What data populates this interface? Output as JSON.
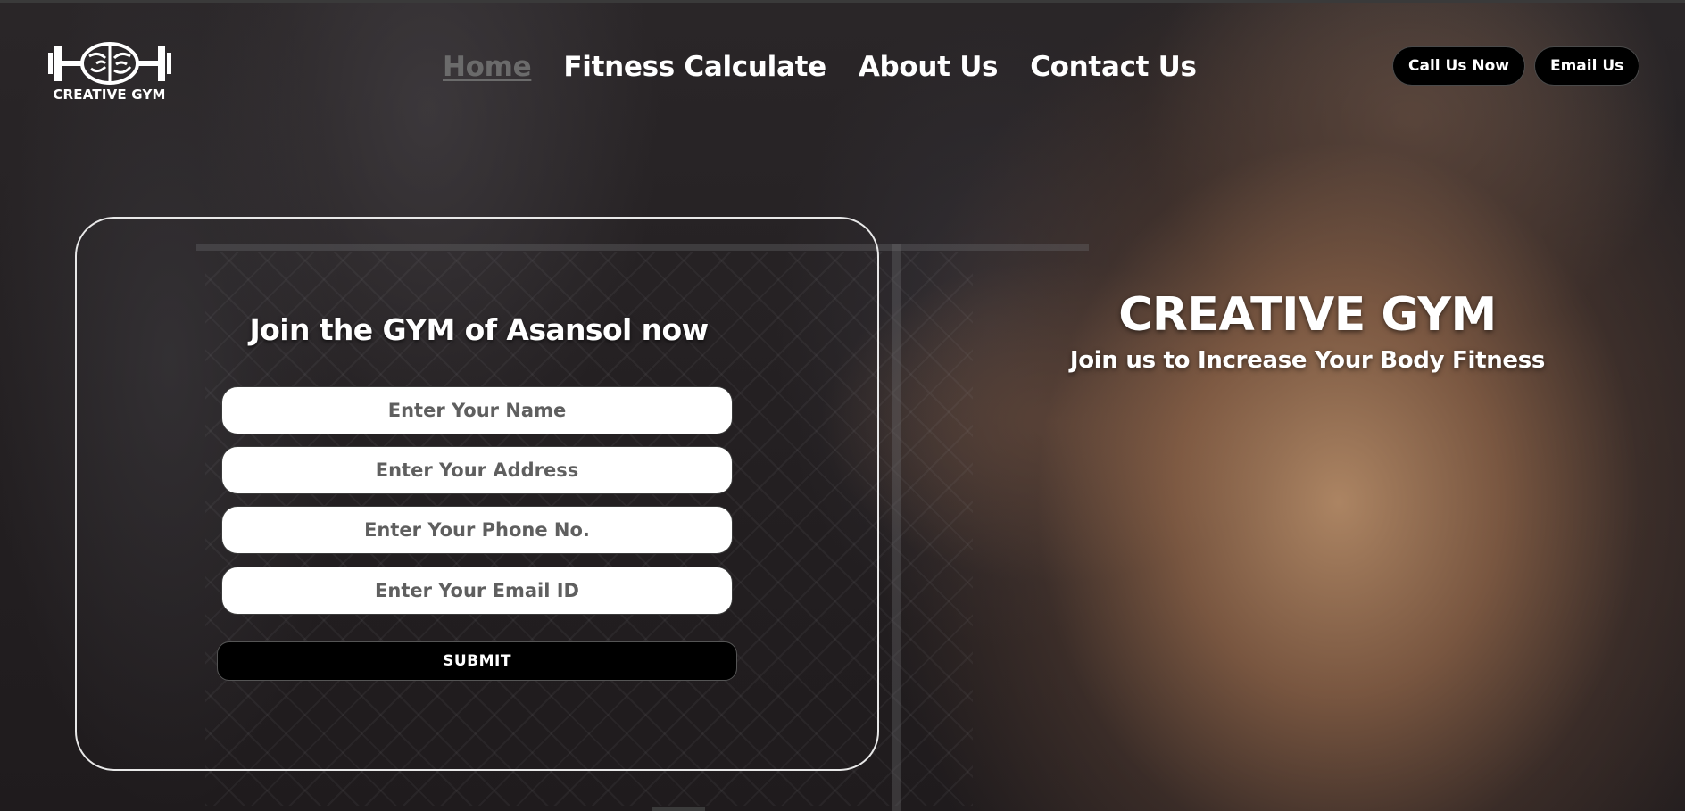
{
  "header": {
    "logo": {
      "icon": "dumbbell-brain-icon",
      "text": "CREATIVE GYM"
    },
    "nav": [
      {
        "label": "Home",
        "active": true
      },
      {
        "label": "Fitness Calculate",
        "active": false
      },
      {
        "label": "About Us",
        "active": false
      },
      {
        "label": "Contact Us",
        "active": false
      }
    ],
    "buttons": {
      "call": "Call Us Now",
      "email": "Email Us"
    }
  },
  "form": {
    "title": "Join the GYM of Asansol now",
    "fields": {
      "name_placeholder": "Enter Your Name",
      "address_placeholder": "Enter Your Address",
      "phone_placeholder": "Enter Your Phone No.",
      "email_placeholder": "Enter Your Email ID"
    },
    "submit_label": "SUBMIT"
  },
  "hero": {
    "title": "CREATIVE GYM",
    "subtitle": "Join us to Increase Your Body Fitness"
  },
  "colors": {
    "background": "#231f21",
    "text": "#ffffff",
    "nav_active": "#6b6b6b",
    "button_bg": "#000000",
    "field_bg": "#ffffff",
    "card_border": "#e8e8e8"
  }
}
